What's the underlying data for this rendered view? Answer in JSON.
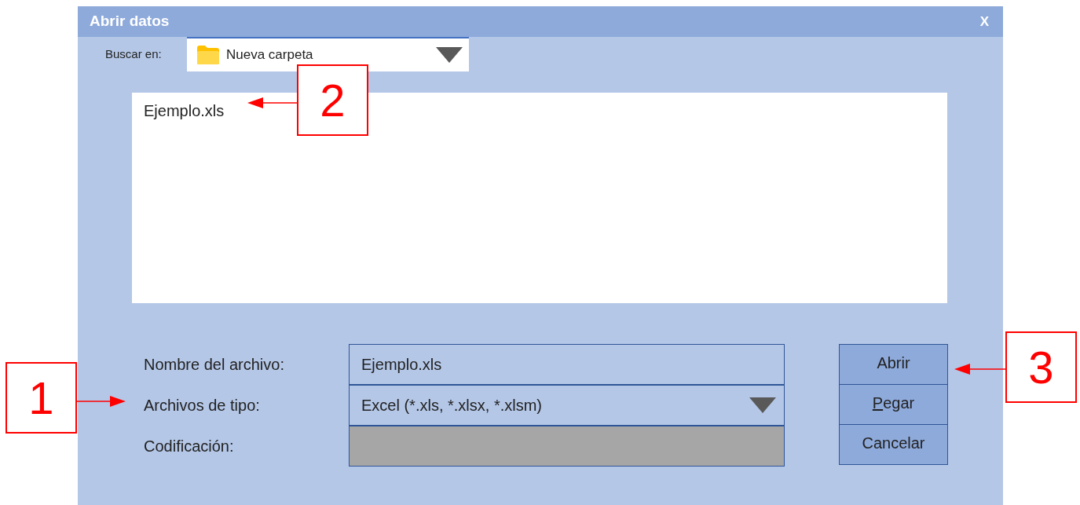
{
  "window": {
    "title": "Abrir datos",
    "close": "X"
  },
  "look_in": {
    "label": "Buscar en:",
    "value": "Nueva carpeta"
  },
  "files": [
    {
      "name": "Ejemplo.xls",
      "selected": false
    }
  ],
  "fields": [
    {
      "kind": "text",
      "label": "Nombre del archivo:",
      "value": "Ejemplo.xls",
      "disabled": false
    },
    {
      "kind": "dropdown",
      "label": "Archivos de tipo:",
      "value": "Excel (*.xls, *.xlsx, *.xlsm)",
      "disabled": false
    },
    {
      "kind": "text",
      "label": "Codificación:",
      "disabled": true
    }
  ],
  "buttons": [
    {
      "label": "Abrir",
      "underline_first": false
    },
    {
      "label": "Pegar",
      "underline_first": true
    },
    {
      "label": "Cancelar",
      "underline_first": false
    }
  ],
  "callouts": [
    {
      "label": "1"
    },
    {
      "label": "2"
    },
    {
      "label": "3"
    }
  ]
}
